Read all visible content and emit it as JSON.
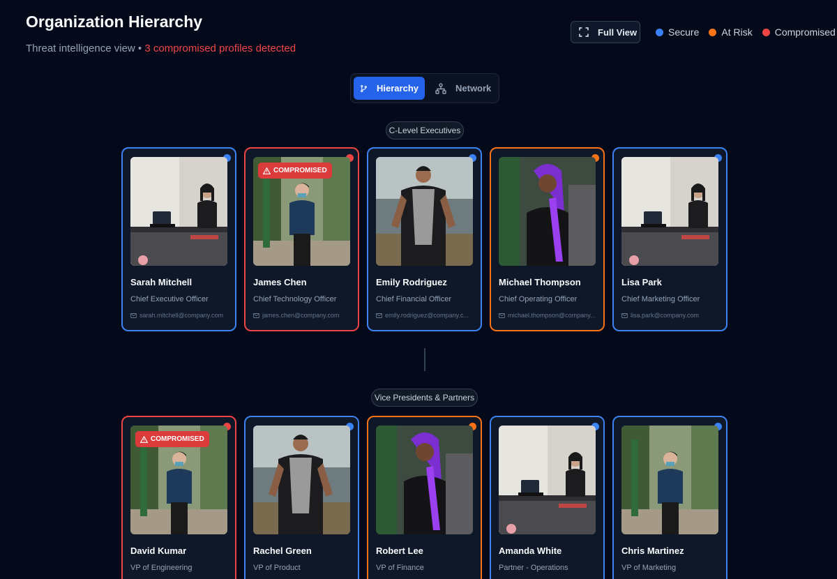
{
  "header": {
    "title": "Organization Hierarchy",
    "subtitle_prefix": "Threat intelligence view • ",
    "subtitle_alert": "3 compromised profiles detected",
    "fullview_label": "Full View"
  },
  "legend": [
    {
      "label": "Secure",
      "color": "#3b82f6"
    },
    {
      "label": "At Risk",
      "color": "#f97316"
    },
    {
      "label": "Compromised",
      "color": "#ef4444"
    }
  ],
  "view_tabs": [
    {
      "label": "Hierarchy",
      "icon": "branch-icon",
      "active": true
    },
    {
      "label": "Network",
      "icon": "network-icon",
      "active": false
    }
  ],
  "levels": [
    {
      "label": "C-Level Executives",
      "people": [
        {
          "name": "Sarah Mitchell",
          "role": "Chief Executive Officer",
          "email": "sarah.mitchell@company.com",
          "status": "secure",
          "photo": "office-woman"
        },
        {
          "name": "James Chen",
          "role": "Chief Technology Officer",
          "email": "james.chen@company.com",
          "status": "compromised",
          "photo": "street-man"
        },
        {
          "name": "Emily Rodriguez",
          "role": "Chief Financial Officer",
          "email": "emily.rodriguez@company.c...",
          "status": "secure",
          "photo": "vest-man"
        },
        {
          "name": "Michael Thompson",
          "role": "Chief Operating Officer",
          "email": "michael.thompson@company...",
          "status": "at-risk",
          "photo": "purple-hair-woman"
        },
        {
          "name": "Lisa Park",
          "role": "Chief Marketing Officer",
          "email": "lisa.park@company.com",
          "status": "secure",
          "photo": "office-woman"
        }
      ]
    },
    {
      "label": "Vice Presidents & Partners",
      "people": [
        {
          "name": "David Kumar",
          "role": "VP of Engineering",
          "email": "",
          "status": "compromised",
          "photo": "street-man"
        },
        {
          "name": "Rachel Green",
          "role": "VP of Product",
          "email": "",
          "status": "secure",
          "photo": "vest-man"
        },
        {
          "name": "Robert Lee",
          "role": "VP of Finance",
          "email": "",
          "status": "at-risk",
          "photo": "purple-hair-woman"
        },
        {
          "name": "Amanda White",
          "role": "Partner - Operations",
          "email": "",
          "status": "secure",
          "photo": "office-woman"
        },
        {
          "name": "Chris Martinez",
          "role": "VP of Marketing",
          "email": "",
          "status": "secure",
          "photo": "street-man"
        }
      ]
    }
  ],
  "badge_label": "COMPROMISED",
  "status_colors": {
    "secure": "#3b82f6",
    "at-risk": "#f97316",
    "compromised": "#ef4444"
  }
}
